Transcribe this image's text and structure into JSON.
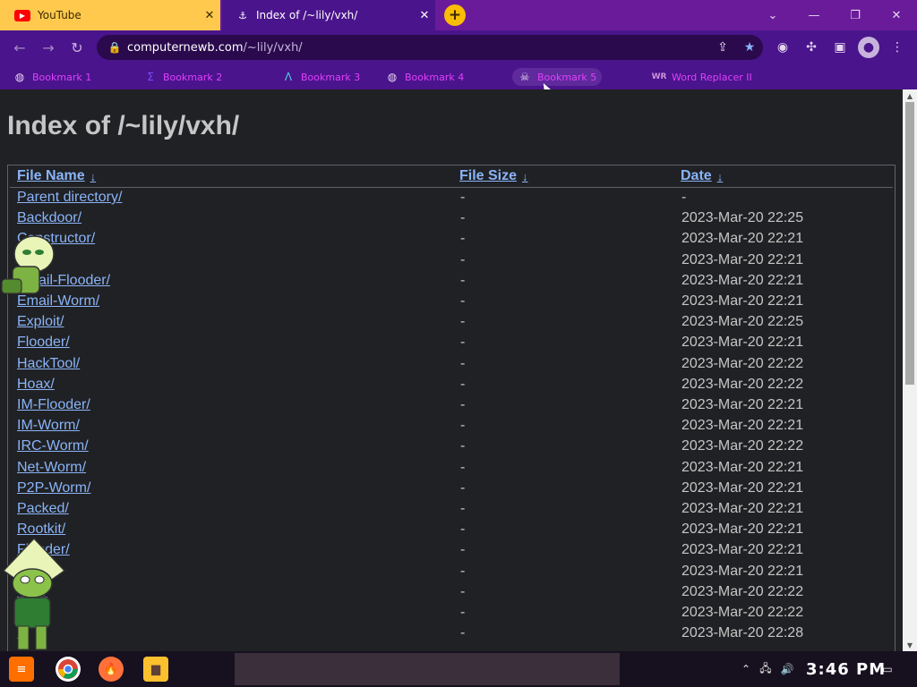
{
  "browser": {
    "tabs": [
      {
        "title": "YouTube",
        "icon": "youtube-icon",
        "close": "✕"
      },
      {
        "title": "Index of /~lily/vxh/",
        "icon": "site-icon",
        "close": "✕"
      }
    ],
    "new_tab": "+",
    "window_controls": {
      "tab_search": "⌄",
      "minimize": "—",
      "maximize": "❐",
      "close": "✕"
    },
    "address": {
      "host": "computernewb.com",
      "path": "/~lily/vxh/"
    },
    "bookmarks": [
      {
        "label": "Bookmark 1",
        "icon": "globe-icon"
      },
      {
        "label": "Bookmark 2",
        "icon": "bookmark-icon"
      },
      {
        "label": "Bookmark 3",
        "icon": "arrow-icon"
      },
      {
        "label": "Bookmark 4",
        "icon": "globe-icon"
      },
      {
        "label": "Bookmark 5",
        "icon": "skull-icon"
      },
      {
        "label": "Word Replacer II",
        "icon": "wr-icon"
      }
    ]
  },
  "page": {
    "title": "Index of /~lily/vxh/",
    "headers": {
      "name": "File Name",
      "size": "File Size",
      "date": "Date",
      "sort": "↓"
    },
    "rows": [
      {
        "name": "Parent directory/",
        "size": "-",
        "date": "-"
      },
      {
        "name": "Backdoor/",
        "size": "-",
        "date": "2023-Mar-20 22:25"
      },
      {
        "name": "Constructor/",
        "size": "-",
        "date": "2023-Mar-20 22:21"
      },
      {
        "name": "",
        "size": "-",
        "date": "2023-Mar-20 22:21"
      },
      {
        "name": "Email-Flooder/",
        "size": "-",
        "date": "2023-Mar-20 22:21"
      },
      {
        "name": "Email-Worm/",
        "size": "-",
        "date": "2023-Mar-20 22:21"
      },
      {
        "name": "Exploit/",
        "size": "-",
        "date": "2023-Mar-20 22:25"
      },
      {
        "name": "Flooder/",
        "size": "-",
        "date": "2023-Mar-20 22:21"
      },
      {
        "name": "HackTool/",
        "size": "-",
        "date": "2023-Mar-20 22:22"
      },
      {
        "name": "Hoax/",
        "size": "-",
        "date": "2023-Mar-20 22:22"
      },
      {
        "name": "IM-Flooder/",
        "size": "-",
        "date": "2023-Mar-20 22:21"
      },
      {
        "name": "IM-Worm/",
        "size": "-",
        "date": "2023-Mar-20 22:21"
      },
      {
        "name": "IRC-Worm/",
        "size": "-",
        "date": "2023-Mar-20 22:22"
      },
      {
        "name": "Net-Worm/",
        "size": "-",
        "date": "2023-Mar-20 22:21"
      },
      {
        "name": "P2P-Worm/",
        "size": "-",
        "date": "2023-Mar-20 22:21"
      },
      {
        "name": "Packed/",
        "size": "-",
        "date": "2023-Mar-20 22:21"
      },
      {
        "name": "Rootkit/",
        "size": "-",
        "date": "2023-Mar-20 22:21"
      },
      {
        "name": "Flooder/",
        "size": "-",
        "date": "2023-Mar-20 22:21"
      },
      {
        "name": "",
        "size": "-",
        "date": "2023-Mar-20 22:21"
      },
      {
        "name": "Tool/",
        "size": "-",
        "date": "2023-Mar-20 22:22"
      },
      {
        "name": "fer/",
        "size": "-",
        "date": "2023-Mar-20 22:22"
      },
      {
        "name": "a/",
        "size": "-",
        "date": "2023-Mar-20 22:28"
      }
    ]
  },
  "taskbar": {
    "clock": "3:46 PM",
    "apps": [
      "start-icon",
      "chrome-icon",
      "firefox-icon",
      "folder-icon"
    ]
  },
  "colors": {
    "tab_yellow": "#ffc94d",
    "chrome_purple": "#4a148c",
    "bookmark_magenta": "#e040fb",
    "link_blue": "#8ab4f8",
    "page_bg": "#202124"
  }
}
